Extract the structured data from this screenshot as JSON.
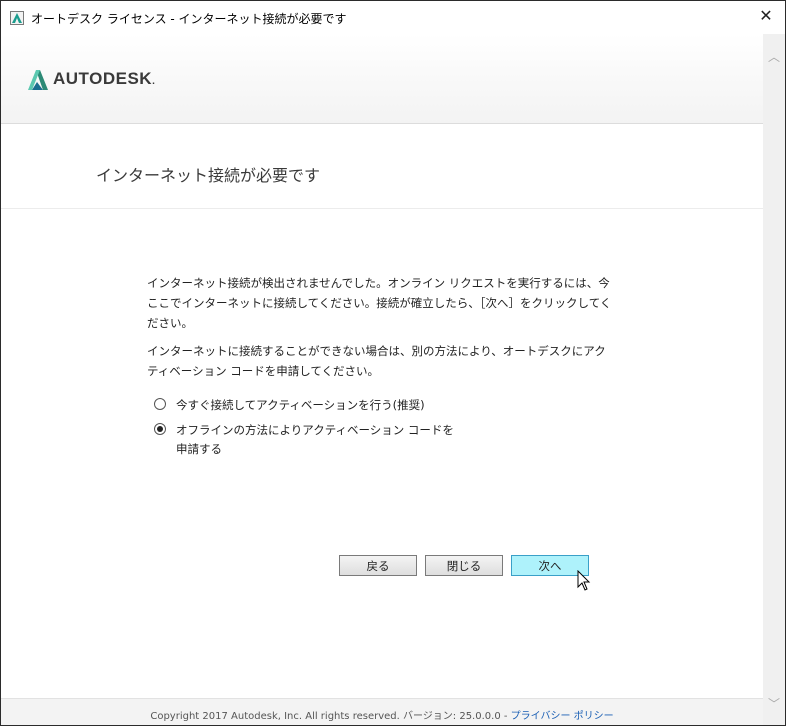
{
  "window": {
    "title": "オートデスク ライセンス - インターネット接続が必要です",
    "close_glyph": "✕"
  },
  "brand": {
    "name": "AUTODESK",
    "dot": "."
  },
  "page": {
    "heading": "インターネット接続が必要です",
    "paragraph1": "インターネット接続が検出されませんでした。オンライン リクエストを実行するには、今ここでインターネットに接続してください。接続が確立したら、［次へ］をクリックしてください。",
    "paragraph2": "インターネットに接続することができない場合は、別の方法により、オートデスクにアクティベーション コードを申請してください。"
  },
  "options": [
    {
      "label": "今すぐ接続してアクティベーションを行う(推奨)",
      "selected": false
    },
    {
      "label": "オフラインの方法によりアクティベーション コードを申請する",
      "selected": true
    }
  ],
  "buttons": {
    "back": "戻る",
    "close": "閉じる",
    "next": "次へ"
  },
  "footer": {
    "copyright": "Copyright 2017 Autodesk, Inc. All rights reserved. バージョン: 25.0.0.0 - ",
    "privacy_link": "プライバシー ポリシー"
  },
  "colors": {
    "next_button_bg": "#aef2fb",
    "link": "#1a5fb4",
    "logo_accent": "#1b9d8e"
  },
  "icons": {
    "app": "autodesk-app-icon",
    "logo": "autodesk-logo-icon",
    "close": "close-icon",
    "cursor": "mouse-pointer-icon"
  }
}
